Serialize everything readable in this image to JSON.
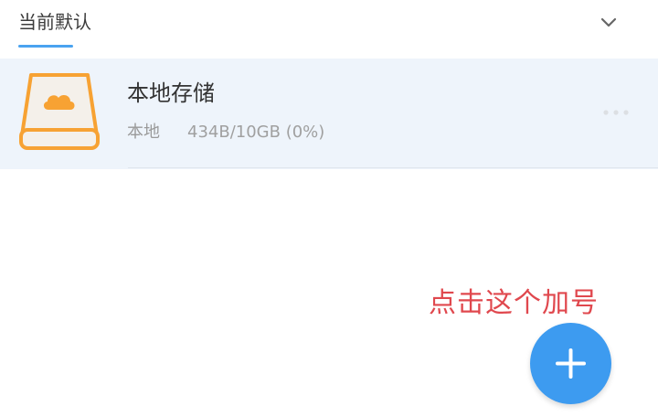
{
  "header": {
    "tab_label": "当前默认",
    "expand_icon": "chevron-down-icon",
    "accent_color": "#4aa3f0"
  },
  "storage": {
    "icon": "cloud-drive-icon",
    "icon_color": "#f7a233",
    "name": "本地存储",
    "type": "本地",
    "usage": "434B/10GB (0%)",
    "more_icon": "more-horizontal-icon"
  },
  "annotation": {
    "text": "点击这个加号",
    "color": "#e0484e"
  },
  "fab": {
    "icon": "plus-icon",
    "color": "#3d9bf0"
  }
}
